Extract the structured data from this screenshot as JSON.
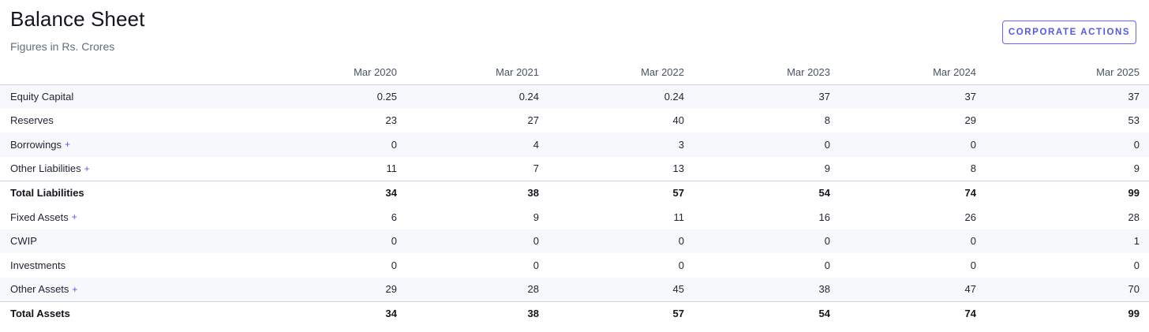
{
  "header": {
    "title": "Balance Sheet",
    "subtitle": "Figures in Rs. Crores",
    "action_button": "CORPORATE ACTIONS"
  },
  "table": {
    "columns": [
      "Mar 2020",
      "Mar 2021",
      "Mar 2022",
      "Mar 2023",
      "Mar 2024",
      "Mar 2025"
    ],
    "rows": [
      {
        "label": "Equity Capital",
        "expandable": false,
        "total": false,
        "values": [
          "0.25",
          "0.24",
          "0.24",
          "37",
          "37",
          "37"
        ]
      },
      {
        "label": "Reserves",
        "expandable": false,
        "total": false,
        "values": [
          "23",
          "27",
          "40",
          "8",
          "29",
          "53"
        ]
      },
      {
        "label": "Borrowings",
        "expandable": true,
        "total": false,
        "values": [
          "0",
          "4",
          "3",
          "0",
          "0",
          "0"
        ]
      },
      {
        "label": "Other Liabilities",
        "expandable": true,
        "total": false,
        "values": [
          "11",
          "7",
          "13",
          "9",
          "8",
          "9"
        ]
      },
      {
        "label": "Total Liabilities",
        "expandable": false,
        "total": true,
        "values": [
          "34",
          "38",
          "57",
          "54",
          "74",
          "99"
        ]
      },
      {
        "label": "Fixed Assets",
        "expandable": true,
        "total": false,
        "values": [
          "6",
          "9",
          "11",
          "16",
          "26",
          "28"
        ]
      },
      {
        "label": "CWIP",
        "expandable": false,
        "total": false,
        "values": [
          "0",
          "0",
          "0",
          "0",
          "0",
          "1"
        ]
      },
      {
        "label": "Investments",
        "expandable": false,
        "total": false,
        "values": [
          "0",
          "0",
          "0",
          "0",
          "0",
          "0"
        ]
      },
      {
        "label": "Other Assets",
        "expandable": true,
        "total": false,
        "values": [
          "29",
          "28",
          "45",
          "38",
          "47",
          "70"
        ]
      },
      {
        "label": "Total Assets",
        "expandable": false,
        "total": true,
        "values": [
          "34",
          "38",
          "57",
          "54",
          "74",
          "99"
        ]
      }
    ],
    "expand_symbol": "+"
  },
  "colors": {
    "accent": "#5558e6",
    "stripe": "#f7f8fc",
    "divider": "#cdd3e8"
  }
}
